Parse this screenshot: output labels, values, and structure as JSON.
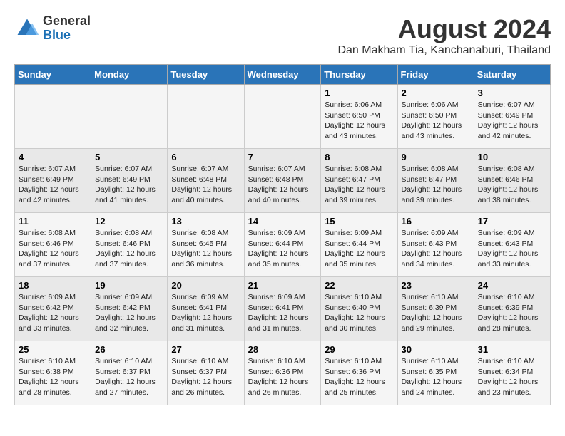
{
  "header": {
    "logo_general": "General",
    "logo_blue": "Blue",
    "main_title": "August 2024",
    "sub_title": "Dan Makham Tia, Kanchanaburi, Thailand"
  },
  "days_of_week": [
    "Sunday",
    "Monday",
    "Tuesday",
    "Wednesday",
    "Thursday",
    "Friday",
    "Saturday"
  ],
  "weeks": [
    [
      {
        "day": "",
        "info": ""
      },
      {
        "day": "",
        "info": ""
      },
      {
        "day": "",
        "info": ""
      },
      {
        "day": "",
        "info": ""
      },
      {
        "day": "1",
        "info": "Sunrise: 6:06 AM\nSunset: 6:50 PM\nDaylight: 12 hours\nand 43 minutes."
      },
      {
        "day": "2",
        "info": "Sunrise: 6:06 AM\nSunset: 6:50 PM\nDaylight: 12 hours\nand 43 minutes."
      },
      {
        "day": "3",
        "info": "Sunrise: 6:07 AM\nSunset: 6:49 PM\nDaylight: 12 hours\nand 42 minutes."
      }
    ],
    [
      {
        "day": "4",
        "info": "Sunrise: 6:07 AM\nSunset: 6:49 PM\nDaylight: 12 hours\nand 42 minutes."
      },
      {
        "day": "5",
        "info": "Sunrise: 6:07 AM\nSunset: 6:49 PM\nDaylight: 12 hours\nand 41 minutes."
      },
      {
        "day": "6",
        "info": "Sunrise: 6:07 AM\nSunset: 6:48 PM\nDaylight: 12 hours\nand 40 minutes."
      },
      {
        "day": "7",
        "info": "Sunrise: 6:07 AM\nSunset: 6:48 PM\nDaylight: 12 hours\nand 40 minutes."
      },
      {
        "day": "8",
        "info": "Sunrise: 6:08 AM\nSunset: 6:47 PM\nDaylight: 12 hours\nand 39 minutes."
      },
      {
        "day": "9",
        "info": "Sunrise: 6:08 AM\nSunset: 6:47 PM\nDaylight: 12 hours\nand 39 minutes."
      },
      {
        "day": "10",
        "info": "Sunrise: 6:08 AM\nSunset: 6:46 PM\nDaylight: 12 hours\nand 38 minutes."
      }
    ],
    [
      {
        "day": "11",
        "info": "Sunrise: 6:08 AM\nSunset: 6:46 PM\nDaylight: 12 hours\nand 37 minutes."
      },
      {
        "day": "12",
        "info": "Sunrise: 6:08 AM\nSunset: 6:46 PM\nDaylight: 12 hours\nand 37 minutes."
      },
      {
        "day": "13",
        "info": "Sunrise: 6:08 AM\nSunset: 6:45 PM\nDaylight: 12 hours\nand 36 minutes."
      },
      {
        "day": "14",
        "info": "Sunrise: 6:09 AM\nSunset: 6:44 PM\nDaylight: 12 hours\nand 35 minutes."
      },
      {
        "day": "15",
        "info": "Sunrise: 6:09 AM\nSunset: 6:44 PM\nDaylight: 12 hours\nand 35 minutes."
      },
      {
        "day": "16",
        "info": "Sunrise: 6:09 AM\nSunset: 6:43 PM\nDaylight: 12 hours\nand 34 minutes."
      },
      {
        "day": "17",
        "info": "Sunrise: 6:09 AM\nSunset: 6:43 PM\nDaylight: 12 hours\nand 33 minutes."
      }
    ],
    [
      {
        "day": "18",
        "info": "Sunrise: 6:09 AM\nSunset: 6:42 PM\nDaylight: 12 hours\nand 33 minutes."
      },
      {
        "day": "19",
        "info": "Sunrise: 6:09 AM\nSunset: 6:42 PM\nDaylight: 12 hours\nand 32 minutes."
      },
      {
        "day": "20",
        "info": "Sunrise: 6:09 AM\nSunset: 6:41 PM\nDaylight: 12 hours\nand 31 minutes."
      },
      {
        "day": "21",
        "info": "Sunrise: 6:09 AM\nSunset: 6:41 PM\nDaylight: 12 hours\nand 31 minutes."
      },
      {
        "day": "22",
        "info": "Sunrise: 6:10 AM\nSunset: 6:40 PM\nDaylight: 12 hours\nand 30 minutes."
      },
      {
        "day": "23",
        "info": "Sunrise: 6:10 AM\nSunset: 6:39 PM\nDaylight: 12 hours\nand 29 minutes."
      },
      {
        "day": "24",
        "info": "Sunrise: 6:10 AM\nSunset: 6:39 PM\nDaylight: 12 hours\nand 28 minutes."
      }
    ],
    [
      {
        "day": "25",
        "info": "Sunrise: 6:10 AM\nSunset: 6:38 PM\nDaylight: 12 hours\nand 28 minutes."
      },
      {
        "day": "26",
        "info": "Sunrise: 6:10 AM\nSunset: 6:37 PM\nDaylight: 12 hours\nand 27 minutes."
      },
      {
        "day": "27",
        "info": "Sunrise: 6:10 AM\nSunset: 6:37 PM\nDaylight: 12 hours\nand 26 minutes."
      },
      {
        "day": "28",
        "info": "Sunrise: 6:10 AM\nSunset: 6:36 PM\nDaylight: 12 hours\nand 26 minutes."
      },
      {
        "day": "29",
        "info": "Sunrise: 6:10 AM\nSunset: 6:36 PM\nDaylight: 12 hours\nand 25 minutes."
      },
      {
        "day": "30",
        "info": "Sunrise: 6:10 AM\nSunset: 6:35 PM\nDaylight: 12 hours\nand 24 minutes."
      },
      {
        "day": "31",
        "info": "Sunrise: 6:10 AM\nSunset: 6:34 PM\nDaylight: 12 hours\nand 23 minutes."
      }
    ]
  ]
}
